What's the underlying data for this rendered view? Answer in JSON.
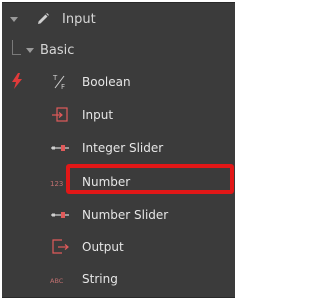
{
  "panel": {
    "top_category": {
      "label": "Input",
      "icon": "pencil-icon",
      "expanded": true
    },
    "sub_category": {
      "label": "Basic",
      "expanded": true
    },
    "section_marker_icon": "lightning-bolt-icon",
    "accent_color": "#e21717",
    "items": [
      {
        "label": "Boolean",
        "icon": "boolean-icon",
        "icon_text": "T/F",
        "highlighted": false
      },
      {
        "label": "Input",
        "icon": "input-icon",
        "highlighted": false
      },
      {
        "label": "Integer Slider",
        "icon": "integer-slider-icon",
        "highlighted": false
      },
      {
        "label": "Number",
        "icon": "number-icon",
        "icon_text": "123",
        "highlighted": true
      },
      {
        "label": "Number Slider",
        "icon": "number-slider-icon",
        "highlighted": false
      },
      {
        "label": "Output",
        "icon": "output-icon",
        "highlighted": false
      },
      {
        "label": "String",
        "icon": "string-icon",
        "icon_text": "ABC",
        "highlighted": false
      }
    ]
  }
}
